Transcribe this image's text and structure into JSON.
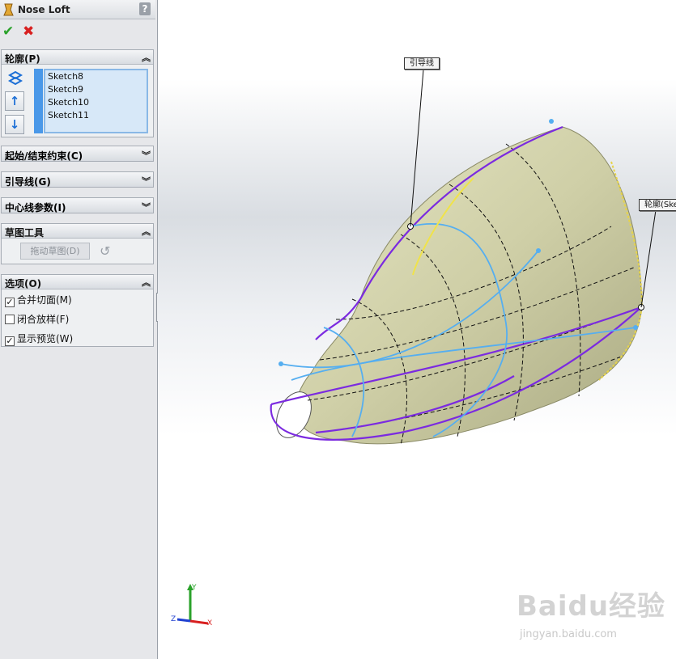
{
  "feature": {
    "title": "Nose Loft",
    "help": "?",
    "ok": "✔",
    "cancel": "✖"
  },
  "profiles": {
    "header": "轮廓(P)",
    "items": [
      "Sketch8",
      "Sketch9",
      "Sketch10",
      "Sketch11"
    ],
    "up": "↑",
    "down": "↓"
  },
  "collapsed_sections": [
    "起始/结束约束(C)",
    "引导线(G)",
    "中心线参数(I)"
  ],
  "sketch_tools": {
    "header": "草图工具",
    "drag_button": "拖动草图(D)",
    "undo": "↺"
  },
  "options": {
    "header": "选项(O)",
    "items": [
      {
        "label": "合并切面(M)",
        "checked": "✓"
      },
      {
        "label": "闭合放样(F)",
        "checked": ""
      },
      {
        "label": "显示预览(W)",
        "checked": "✓"
      }
    ]
  },
  "callouts": {
    "guide": "引导线",
    "profile": "轮廓(Ske"
  },
  "triad": {
    "x": "X",
    "y": "Y",
    "z": "Z"
  },
  "watermark": {
    "brand": "Baidu经验",
    "url": "jingyan.baidu.com"
  },
  "colors": {
    "surface": "#cfcfa7",
    "profile_curve": "#7b2ae0",
    "guide_curve": "#55aef0",
    "accent_ok": "#2aa22a",
    "accent_cancel": "#d82020"
  }
}
